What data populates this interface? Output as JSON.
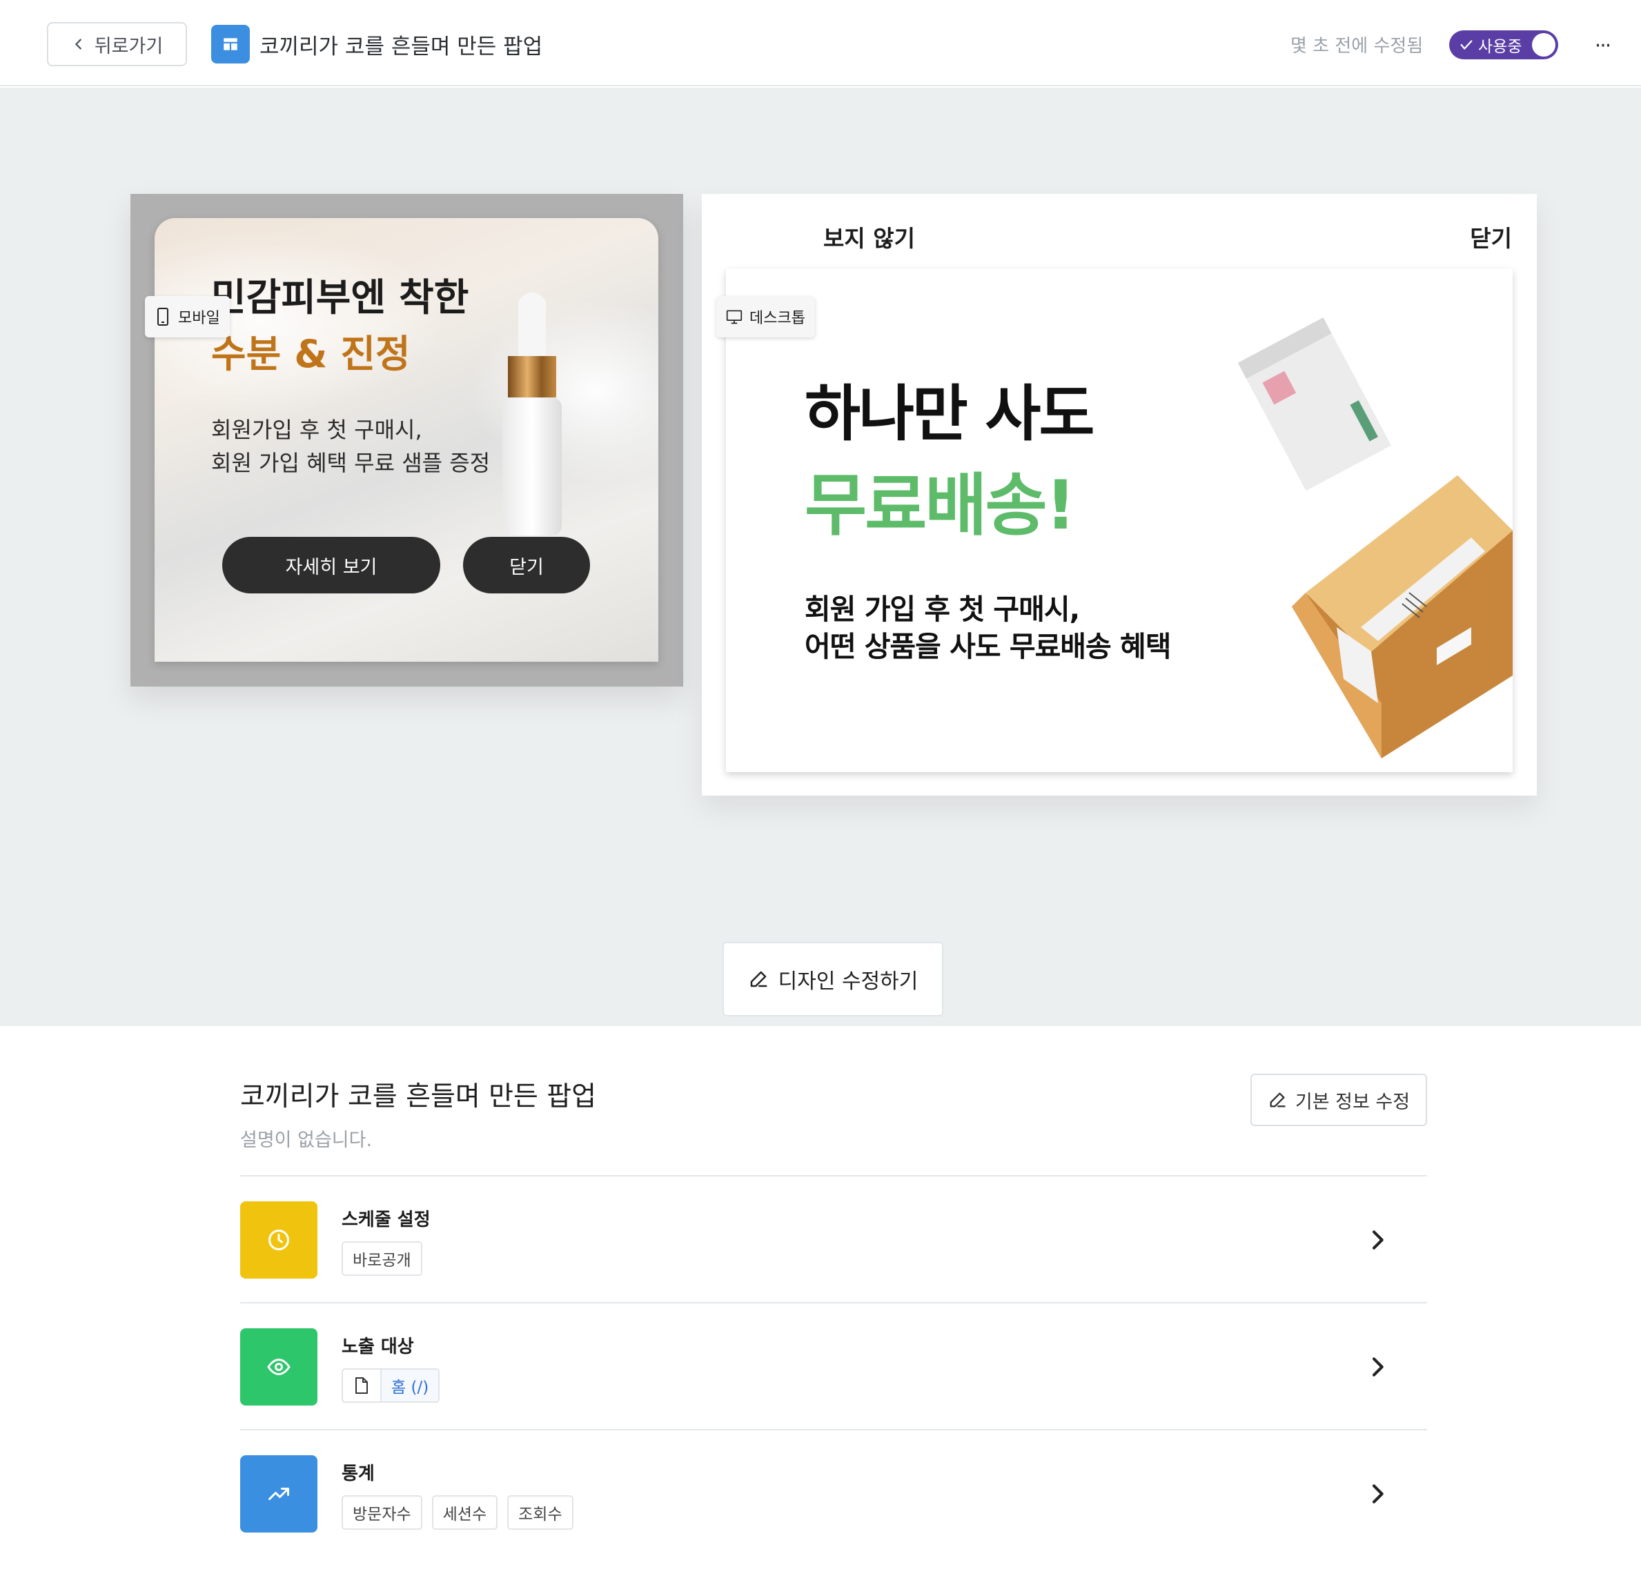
{
  "header": {
    "back_label": "뒤로가기",
    "title": "코끼리가 코를 흔들며 만든 팝업",
    "modified_text": "몇 초 전에 수정됨",
    "toggle_label": "사용중",
    "toggle_on": true,
    "more_label": "···"
  },
  "preview": {
    "mobile_chip": "모바일",
    "desktop_chip": "데스크톱",
    "mobile_popup": {
      "headline1": "민감피부엔 착한",
      "headline2": "수분 & 진정",
      "desc1": "회원가입 후 첫 구매시,",
      "desc2": "회원 가입 혜택 무료 샘플 증정",
      "detail_button": "자세히 보기",
      "close_button": "닫기"
    },
    "desktop_popup": {
      "dont_show": "보지 않기",
      "close": "닫기",
      "title1": "하나만 사도",
      "title2": "무료배송!",
      "desc1": "회원 가입 후 첫 구매시,",
      "desc2": "어떤 상품을 사도 무료배송 혜택"
    },
    "design_edit_button": "디자인 수정하기"
  },
  "info": {
    "title": "코끼리가 코를 흔들며 만든 팝업",
    "description": "설명이 없습니다.",
    "edit_button": "기본 정보 수정",
    "rows": [
      {
        "title": "스케줄 설정",
        "tags": [
          "바로공개"
        ]
      },
      {
        "title": "노출 대상",
        "page_tag": "홈 (/)"
      },
      {
        "title": "통계",
        "tags": [
          "방문자수",
          "세션수",
          "조회수"
        ]
      }
    ]
  },
  "colors": {
    "accent_purple": "#5a3ea6",
    "popup_icon_blue": "#3b8ee0",
    "schedule_yellow": "#f0c40e",
    "target_green": "#2ec66a",
    "stats_blue": "#3a8fe0",
    "highlight_orange": "#c0741a",
    "highlight_green": "#5dbb6a"
  },
  "icons": {
    "back": "chevron-left-icon",
    "popup": "layout-icon",
    "toggle": "check-icon",
    "mobile": "smartphone-icon",
    "desktop": "monitor-icon",
    "edit": "pencil-icon",
    "schedule": "clock-icon",
    "target": "eye-icon",
    "page": "file-icon",
    "stats": "trending-up-icon",
    "row_action": "chevron-right-icon"
  }
}
